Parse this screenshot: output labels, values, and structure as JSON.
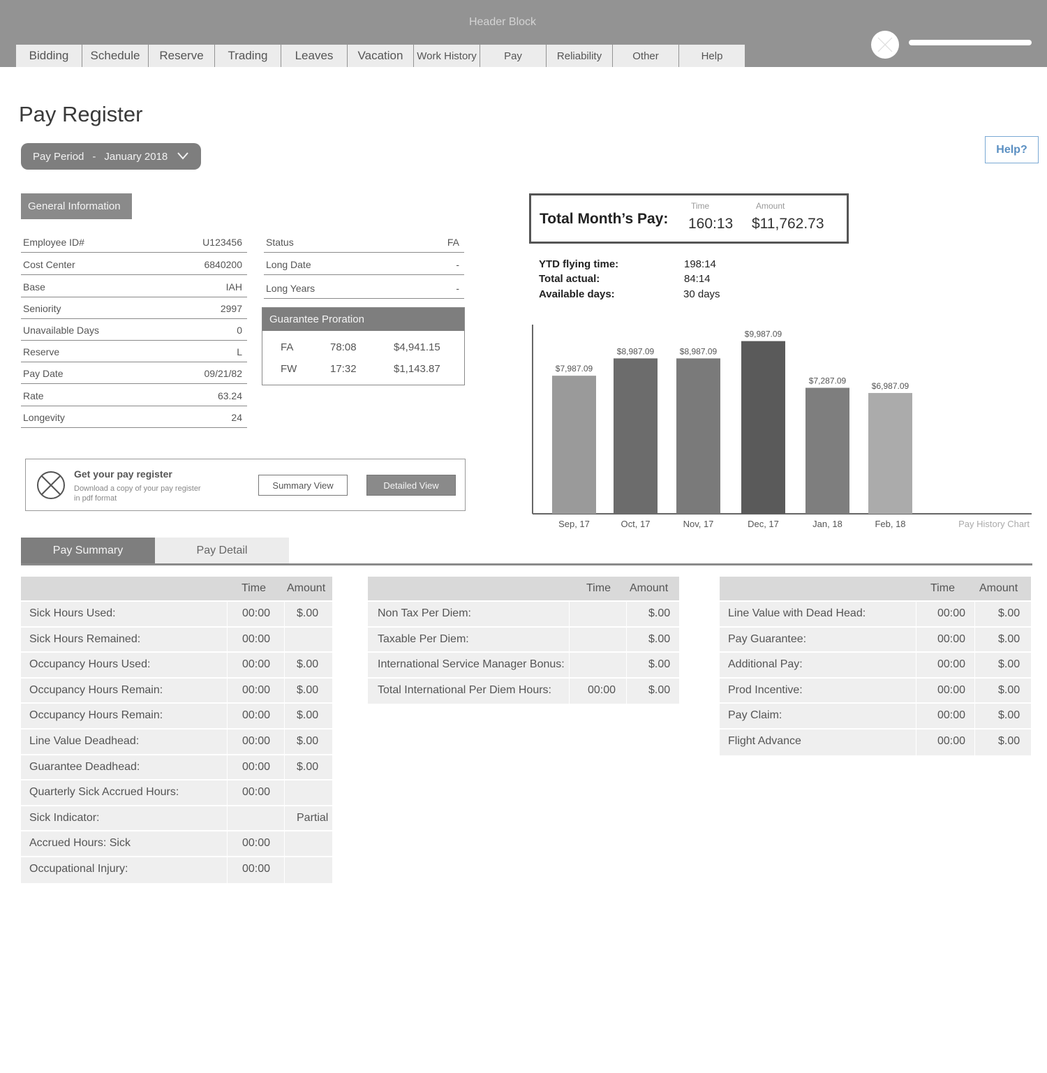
{
  "header": {
    "title": "Header Block",
    "tabs": [
      "Bidding",
      "Schedule",
      "Reserve",
      "Trading",
      "Leaves",
      "Vacation",
      "Work History",
      "Pay",
      "Reliability",
      "Other",
      "Help"
    ]
  },
  "page_title": "Pay Register",
  "pay_period": {
    "label": "Pay Period",
    "separator": "-",
    "value": "January 2018"
  },
  "help_label": "Help?",
  "general_info": {
    "label": "General Information",
    "left": [
      {
        "label": "Employee ID#",
        "value": "U123456"
      },
      {
        "label": "Cost Center",
        "value": "6840200"
      },
      {
        "label": "Base",
        "value": "IAH"
      },
      {
        "label": "Seniority",
        "value": "2997"
      },
      {
        "label": "Unavailable Days",
        "value": "0"
      },
      {
        "label": "Reserve",
        "value": "L"
      },
      {
        "label": "Pay Date",
        "value": "09/21/82"
      },
      {
        "label": "Rate",
        "value": "63.24"
      },
      {
        "label": "Longevity",
        "value": "24"
      }
    ],
    "right": [
      {
        "label": "Status",
        "value": "FA"
      },
      {
        "label": "Long Date",
        "value": "-"
      },
      {
        "label": "Long Years",
        "value": "-"
      }
    ]
  },
  "guarantee": {
    "title": "Guarantee Proration",
    "rows": [
      {
        "code": "FA",
        "time": "78:08",
        "amount": "$4,941.15"
      },
      {
        "code": "FW",
        "time": "17:32",
        "amount": "$1,143.87"
      }
    ]
  },
  "total_month": {
    "label": "Total Month’s Pay:",
    "time_label": "Time",
    "amount_label": "Amount",
    "time": "160:13",
    "amount": "$11,762.73"
  },
  "ytd": [
    {
      "label": "YTD flying time:",
      "value": "198:14"
    },
    {
      "label": "Total actual:",
      "value": "84:14"
    },
    {
      "label": "Available days:",
      "value": "30 days"
    }
  ],
  "download": {
    "title": "Get your pay register",
    "sub_line1": "Download a copy of your pay register",
    "sub_line2": "in pdf format",
    "summary_btn": "Summary View",
    "detailed_btn": "Detailed View"
  },
  "chart_data": {
    "type": "bar",
    "title": "Pay History Chart",
    "categories": [
      "Sep, 17",
      "Oct, 17",
      "Nov, 17",
      "Dec, 17",
      "Jan, 18",
      "Feb, 18"
    ],
    "values": [
      7987.09,
      8987.09,
      8987.09,
      9987.09,
      7287.09,
      6987.09
    ],
    "labels": [
      "$7,987.09",
      "$8,987.09",
      "$8,987.09",
      "$9,987.09",
      "$7,287.09",
      "$6,987.09"
    ],
    "colors": [
      "#9a9a9a",
      "#6c6c6c",
      "#7a7a7a",
      "#5a5a5a",
      "#7e7e7e",
      "#ababab"
    ],
    "grid": false,
    "legend": "none"
  },
  "tabs": {
    "summary": "Pay Summary",
    "detail": "Pay Detail"
  },
  "tables": {
    "time_header": "Time",
    "amount_header": "Amount",
    "left": [
      {
        "label": "Sick Hours Used:",
        "time": "00:00",
        "amount": "$.00"
      },
      {
        "label": "Sick Hours Remained:",
        "time": "00:00",
        "amount": ""
      },
      {
        "label": "Occupancy Hours Used:",
        "time": "00:00",
        "amount": "$.00"
      },
      {
        "label": "Occupancy Hours Remain:",
        "time": "00:00",
        "amount": "$.00"
      },
      {
        "label": "Occupancy Hours Remain:",
        "time": "00:00",
        "amount": "$.00"
      },
      {
        "label": "Line Value  Deadhead:",
        "time": "00:00",
        "amount": "$.00"
      },
      {
        "label": "Guarantee Deadhead:",
        "time": "00:00",
        "amount": "$.00"
      },
      {
        "label": "Quarterly Sick Accrued Hours:",
        "time": "00:00",
        "amount": ""
      },
      {
        "label": "Sick Indicator:",
        "time": "",
        "amount": "Partial"
      },
      {
        "label": "Accrued Hours: Sick",
        "time": "00:00",
        "amount": ""
      },
      {
        "label": "Occupational Injury:",
        "time": "00:00",
        "amount": ""
      }
    ],
    "middle": [
      {
        "label": "Non Tax Per Diem:",
        "time": "",
        "amount": "$.00"
      },
      {
        "label": "Taxable Per Diem:",
        "time": "",
        "amount": "$.00"
      },
      {
        "label": "International Service Manager Bonus:",
        "time": "",
        "amount": "$.00"
      },
      {
        "label": "Total International Per Diem Hours:",
        "time": "00:00",
        "amount": "$.00"
      }
    ],
    "right": [
      {
        "label": "Line Value  with Dead Head:",
        "time": "00:00",
        "amount": "$.00"
      },
      {
        "label": "Pay Guarantee:",
        "time": "00:00",
        "amount": "$.00"
      },
      {
        "label": "Additional Pay:",
        "time": "00:00",
        "amount": "$.00"
      },
      {
        "label": "Prod Incentive:",
        "time": "00:00",
        "amount": "$.00"
      },
      {
        "label": "Pay Claim:",
        "time": "00:00",
        "amount": "$.00"
      },
      {
        "label": "Flight Advance",
        "time": "00:00",
        "amount": "$.00"
      }
    ]
  }
}
